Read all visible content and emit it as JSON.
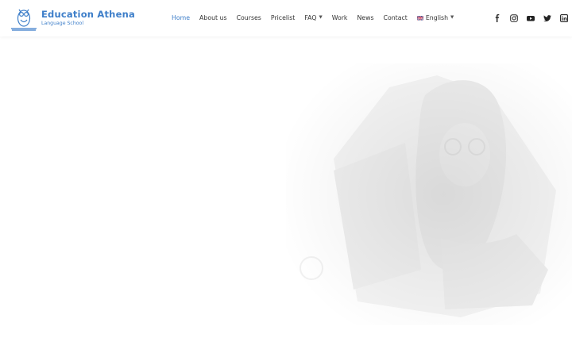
{
  "brand": {
    "name": "Education Athena",
    "tagline": "Language School",
    "color": "#3d7ec9"
  },
  "nav": {
    "items": [
      {
        "label": "Home",
        "active": true
      },
      {
        "label": "About us"
      },
      {
        "label": "Courses"
      },
      {
        "label": "Pricelist"
      },
      {
        "label": "FAQ",
        "has_dropdown": true
      },
      {
        "label": "Work"
      },
      {
        "label": "News"
      },
      {
        "label": "Contact"
      }
    ],
    "language": {
      "label": "English",
      "flag": "uk-flag-icon",
      "has_dropdown": true
    },
    "active_color": "#3d7ec9",
    "text_color": "#333333"
  },
  "social": {
    "icons": [
      "facebook-icon",
      "instagram-icon",
      "youtube-icon",
      "twitter-icon",
      "linkedin-icon"
    ]
  },
  "hero": {
    "image": "faded-woman-with-glasses-photo"
  }
}
